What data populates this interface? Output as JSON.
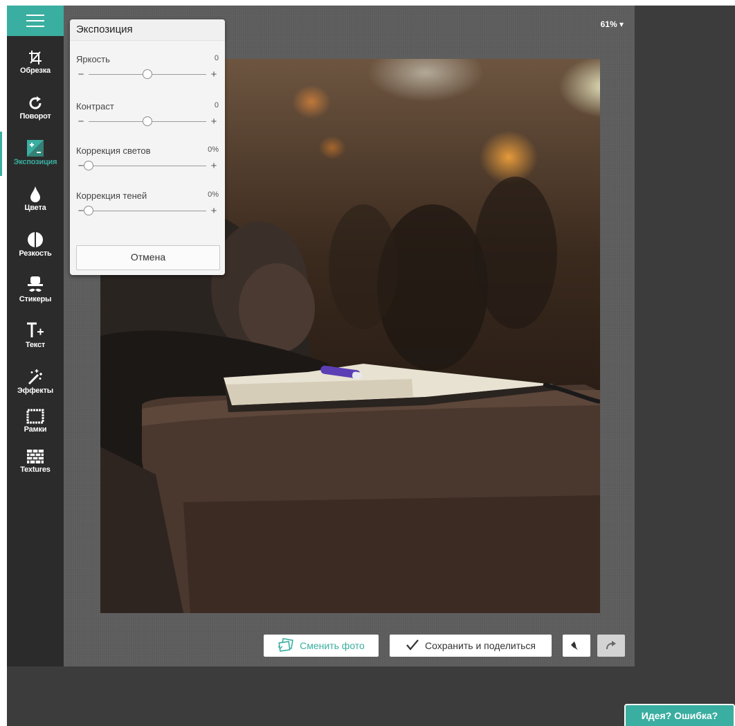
{
  "sidebar": {
    "menu_icon": "hamburger-icon",
    "items": [
      {
        "label": "Обрезка",
        "icon": "crop-icon"
      },
      {
        "label": "Поворот",
        "icon": "rotate-icon"
      },
      {
        "label": "Экспозиция",
        "icon": "exposure-icon",
        "active": true
      },
      {
        "label": "Цвета",
        "icon": "drop-icon"
      },
      {
        "label": "Резкость",
        "icon": "half-circle-icon"
      },
      {
        "label": "Стикеры",
        "icon": "hat-mustache-icon"
      },
      {
        "label": "Текст",
        "icon": "text-plus-icon"
      },
      {
        "label": "Эффекты",
        "icon": "magic-wand-icon"
      },
      {
        "label": "Рамки",
        "icon": "frame-icon"
      },
      {
        "label": "Textures",
        "icon": "brick-icon"
      }
    ]
  },
  "zoom": {
    "value": "61%",
    "icon": "caret-down-icon"
  },
  "panel": {
    "title": "Экспозиция",
    "controls": [
      {
        "label": "Яркость",
        "value": "0",
        "level": 0.5
      },
      {
        "label": "Контраст",
        "value": "0",
        "level": 0.5
      },
      {
        "label": "Коррекция светов",
        "value": "0%",
        "level": 0.0
      },
      {
        "label": "Коррекция теней",
        "value": "0%",
        "level": 0.0
      }
    ],
    "minus": "−",
    "plus": "+",
    "cancel_label": "Отмена"
  },
  "actions": {
    "change_photo": "Сменить фото",
    "save_share": "Сохранить и поделиться",
    "undo_icon": "undo-icon",
    "redo_icon": "redo-icon"
  },
  "feedback": "Идея? Ошибка?",
  "colors": {
    "accent": "#3aaea0",
    "sidebar": "#2b2b2b",
    "canvas": "#5b5b5b"
  }
}
